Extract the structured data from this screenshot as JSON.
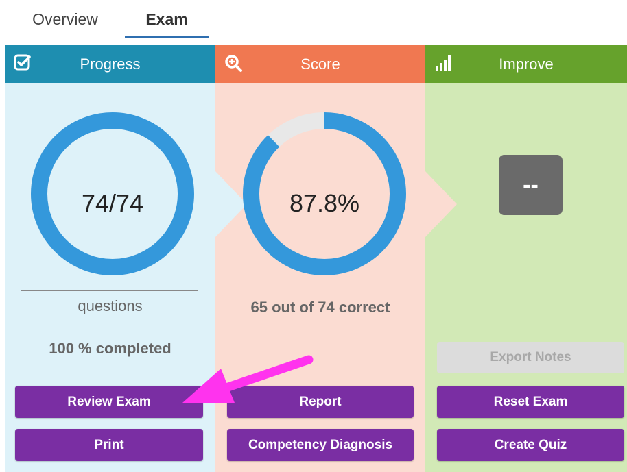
{
  "tabs": {
    "overview": "Overview",
    "exam": "Exam"
  },
  "panels": {
    "progress": {
      "title": "Progress",
      "icon": "checkbox-icon",
      "value": "74/74",
      "fraction": 1.0,
      "caption": "questions",
      "completed": "100 % completed"
    },
    "score": {
      "title": "Score",
      "icon": "magnify-plus-icon",
      "value": "87.8%",
      "fraction": 0.878,
      "summary": "65 out of 74 correct"
    },
    "improve": {
      "title": "Improve",
      "icon": "signal-bars-icon",
      "value": "--"
    }
  },
  "buttons": {
    "review_exam": "Review Exam",
    "print": "Print",
    "report": "Report",
    "competency_diagnosis": "Competency Diagnosis",
    "export_notes": "Export Notes",
    "reset_exam": "Reset Exam",
    "create_quiz": "Create Quiz"
  },
  "colors": {
    "ring_fill": "#3498db",
    "ring_track": "#e8e8e8",
    "button": "#7a2ea3",
    "annotation_arrow": "#ff33ee"
  }
}
